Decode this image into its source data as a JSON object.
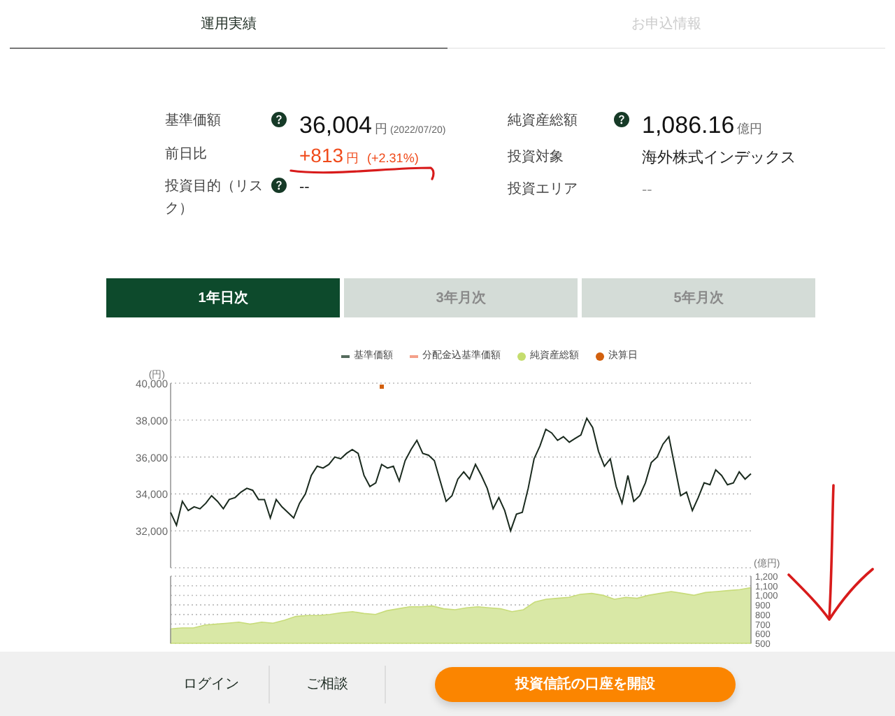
{
  "tabs": [
    {
      "label": "運用実績",
      "selected": true
    },
    {
      "label": "お申込情報",
      "selected": false
    }
  ],
  "fund_info": {
    "left": [
      {
        "label": "基準価額",
        "help": true,
        "kind": "large",
        "value": "36,004",
        "unit": "円",
        "note": "(2022/07/20)"
      },
      {
        "label": "前日比",
        "help": false,
        "kind": "change",
        "value": "+813",
        "unit": "円",
        "note": "(+2.31%)"
      },
      {
        "label": "投資目的（リスク）",
        "help": true,
        "kind": "plain",
        "value": "--"
      }
    ],
    "right": [
      {
        "label": "純資産総額",
        "help": true,
        "kind": "large",
        "value": "1,086.16",
        "unit": "億円"
      },
      {
        "label": "投資対象",
        "help": false,
        "kind": "plain",
        "value": "海外株式インデックス"
      },
      {
        "label": "投資エリア",
        "help": false,
        "kind": "muted",
        "value": "--"
      }
    ]
  },
  "periods": [
    {
      "label": "1年日次",
      "selected": true
    },
    {
      "label": "3年月次",
      "selected": false
    },
    {
      "label": "5年月次",
      "selected": false
    }
  ],
  "legend": [
    {
      "label": "基準価額",
      "kind": "line",
      "color": "#556b5d"
    },
    {
      "label": "分配金込基準価額",
      "kind": "line",
      "color": "#f4a08a"
    },
    {
      "label": "純資産総額",
      "kind": "dot",
      "color": "#c5dd6e"
    },
    {
      "label": "決算日",
      "kind": "dot",
      "color": "#d2600e"
    }
  ],
  "price_chart": {
    "unit_label": "(円)",
    "chart_data": {
      "type": "line",
      "ylim": [
        30000,
        40000
      ],
      "yticks": [
        {
          "value": 32000,
          "label": "32,000"
        },
        {
          "value": 34000,
          "label": "34,000"
        },
        {
          "value": 36000,
          "label": "36,000"
        },
        {
          "value": 38000,
          "label": "38,000"
        },
        {
          "value": 40000,
          "label": "40,000"
        }
      ],
      "grid": true,
      "series": [
        {
          "color": "#1a2a1e",
          "values": [
            33000,
            32300,
            33600,
            33100,
            33300,
            33200,
            33500,
            33900,
            33600,
            33200,
            33700,
            33800,
            34100,
            34300,
            34200,
            33700,
            33700,
            32700,
            33700,
            33300,
            33000,
            32700,
            33500,
            34000,
            35000,
            35500,
            35400,
            35600,
            36000,
            35900,
            36200,
            36400,
            36200,
            35000,
            34400,
            34600,
            35600,
            35400,
            35500,
            34700,
            35800,
            36400,
            36900,
            36200,
            36100,
            35800,
            34700,
            33600,
            33900,
            34800,
            35200,
            34800,
            35600,
            35000,
            34300,
            33200,
            33800,
            33100,
            32000,
            32900,
            33000,
            34300,
            35900,
            36600,
            37500,
            37300,
            36900,
            37100,
            36800,
            37000,
            37200,
            38100,
            37600,
            36300,
            35500,
            35900,
            34400,
            33500,
            35000,
            33600,
            33900,
            34600,
            35700,
            36000,
            36700,
            37100,
            35500,
            33900,
            34100,
            33100,
            33800,
            34600,
            34500,
            35300,
            35000,
            34500,
            34600,
            35200,
            34800,
            35100
          ]
        }
      ]
    }
  },
  "assets_chart": {
    "unit_label": "(億円)",
    "chart_data": {
      "type": "area",
      "ylim": [
        500,
        1200
      ],
      "yticks": [
        {
          "value": 500,
          "label": "500"
        },
        {
          "value": 600,
          "label": "600"
        },
        {
          "value": 700,
          "label": "700"
        },
        {
          "value": 800,
          "label": "800"
        },
        {
          "value": 900,
          "label": "900"
        },
        {
          "value": 1000,
          "label": "1,000"
        },
        {
          "value": 1100,
          "label": "1,100"
        },
        {
          "value": 1200,
          "label": "1,200"
        }
      ],
      "grid": true,
      "series": [
        {
          "color": "#d9e8a6",
          "values": [
            650,
            660,
            660,
            690,
            700,
            710,
            720,
            700,
            720,
            710,
            740,
            780,
            790,
            790,
            800,
            820,
            830,
            810,
            800,
            840,
            860,
            880,
            880,
            890,
            860,
            850,
            870,
            880,
            870,
            860,
            830,
            850,
            930,
            960,
            970,
            980,
            1010,
            1020,
            1000,
            960,
            980,
            970,
            1000,
            1020,
            1040,
            1020,
            1000,
            1030,
            1040,
            1050,
            1060,
            1080
          ]
        }
      ]
    }
  },
  "footer": {
    "links": [
      "ログイン",
      "ご相談"
    ],
    "cta": "投資信託の口座を開設"
  }
}
